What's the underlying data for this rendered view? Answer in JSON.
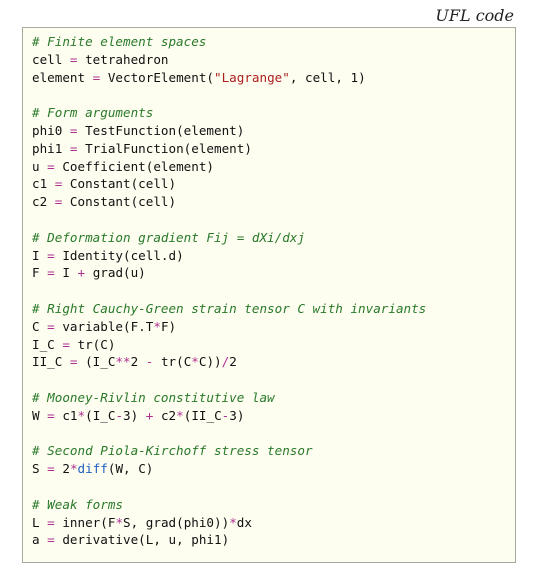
{
  "caption": "UFL code",
  "colors": {
    "comment": "#2a7a2a",
    "string": "#b02020",
    "operator": "#b03090",
    "builtin": "#2060c0",
    "background": "#fdfdf0"
  },
  "code": {
    "lines": [
      {
        "tokens": [
          {
            "t": "# Finite element spaces",
            "c": "comment"
          }
        ]
      },
      {
        "tokens": [
          {
            "t": "cell "
          },
          {
            "t": "=",
            "c": "op"
          },
          {
            "t": " tetrahedron"
          }
        ]
      },
      {
        "tokens": [
          {
            "t": "element "
          },
          {
            "t": "=",
            "c": "op"
          },
          {
            "t": " VectorElement("
          },
          {
            "t": "\"Lagrange\"",
            "c": "string"
          },
          {
            "t": ", cell, 1)"
          }
        ]
      },
      {
        "tokens": []
      },
      {
        "tokens": [
          {
            "t": "# Form arguments",
            "c": "comment"
          }
        ]
      },
      {
        "tokens": [
          {
            "t": "phi0 "
          },
          {
            "t": "=",
            "c": "op"
          },
          {
            "t": " TestFunction(element)"
          }
        ]
      },
      {
        "tokens": [
          {
            "t": "phi1 "
          },
          {
            "t": "=",
            "c": "op"
          },
          {
            "t": " TrialFunction(element)"
          }
        ]
      },
      {
        "tokens": [
          {
            "t": "u "
          },
          {
            "t": "=",
            "c": "op"
          },
          {
            "t": " Coefficient(element)"
          }
        ]
      },
      {
        "tokens": [
          {
            "t": "c1 "
          },
          {
            "t": "=",
            "c": "op"
          },
          {
            "t": " Constant(cell)"
          }
        ]
      },
      {
        "tokens": [
          {
            "t": "c2 "
          },
          {
            "t": "=",
            "c": "op"
          },
          {
            "t": " Constant(cell)"
          }
        ]
      },
      {
        "tokens": []
      },
      {
        "tokens": [
          {
            "t": "# Deformation gradient Fij = dXi/dxj",
            "c": "comment"
          }
        ]
      },
      {
        "tokens": [
          {
            "t": "I "
          },
          {
            "t": "=",
            "c": "op"
          },
          {
            "t": " Identity(cell.d)"
          }
        ]
      },
      {
        "tokens": [
          {
            "t": "F "
          },
          {
            "t": "=",
            "c": "op"
          },
          {
            "t": " I "
          },
          {
            "t": "+",
            "c": "op"
          },
          {
            "t": " grad(u)"
          }
        ]
      },
      {
        "tokens": []
      },
      {
        "tokens": [
          {
            "t": "# Right Cauchy-Green strain tensor C with invariants",
            "c": "comment"
          }
        ]
      },
      {
        "tokens": [
          {
            "t": "C "
          },
          {
            "t": "=",
            "c": "op"
          },
          {
            "t": " variable(F.T"
          },
          {
            "t": "*",
            "c": "op"
          },
          {
            "t": "F)"
          }
        ]
      },
      {
        "tokens": [
          {
            "t": "I_C "
          },
          {
            "t": "=",
            "c": "op"
          },
          {
            "t": " tr(C)"
          }
        ]
      },
      {
        "tokens": [
          {
            "t": "II_C "
          },
          {
            "t": "=",
            "c": "op"
          },
          {
            "t": " (I_C"
          },
          {
            "t": "**",
            "c": "op"
          },
          {
            "t": "2 "
          },
          {
            "t": "-",
            "c": "op"
          },
          {
            "t": " tr(C"
          },
          {
            "t": "*",
            "c": "op"
          },
          {
            "t": "C))"
          },
          {
            "t": "/",
            "c": "op"
          },
          {
            "t": "2"
          }
        ]
      },
      {
        "tokens": []
      },
      {
        "tokens": [
          {
            "t": "# Mooney-Rivlin constitutive law",
            "c": "comment"
          }
        ]
      },
      {
        "tokens": [
          {
            "t": "W "
          },
          {
            "t": "=",
            "c": "op"
          },
          {
            "t": " c1"
          },
          {
            "t": "*",
            "c": "op"
          },
          {
            "t": "(I_C"
          },
          {
            "t": "-",
            "c": "op"
          },
          {
            "t": "3) "
          },
          {
            "t": "+",
            "c": "op"
          },
          {
            "t": " c2"
          },
          {
            "t": "*",
            "c": "op"
          },
          {
            "t": "(II_C"
          },
          {
            "t": "-",
            "c": "op"
          },
          {
            "t": "3)"
          }
        ]
      },
      {
        "tokens": []
      },
      {
        "tokens": [
          {
            "t": "# Second Piola-Kirchoff stress tensor",
            "c": "comment"
          }
        ]
      },
      {
        "tokens": [
          {
            "t": "S "
          },
          {
            "t": "=",
            "c": "op"
          },
          {
            "t": " 2"
          },
          {
            "t": "*",
            "c": "op"
          },
          {
            "t": "diff",
            "c": "fn"
          },
          {
            "t": "(W, C)"
          }
        ]
      },
      {
        "tokens": []
      },
      {
        "tokens": [
          {
            "t": "# Weak forms",
            "c": "comment"
          }
        ]
      },
      {
        "tokens": [
          {
            "t": "L "
          },
          {
            "t": "=",
            "c": "op"
          },
          {
            "t": " inner(F"
          },
          {
            "t": "*",
            "c": "op"
          },
          {
            "t": "S, grad(phi0))"
          },
          {
            "t": "*",
            "c": "op"
          },
          {
            "t": "dx"
          }
        ]
      },
      {
        "tokens": [
          {
            "t": "a "
          },
          {
            "t": "=",
            "c": "op"
          },
          {
            "t": " derivative(L, u, phi1)"
          }
        ]
      }
    ]
  }
}
